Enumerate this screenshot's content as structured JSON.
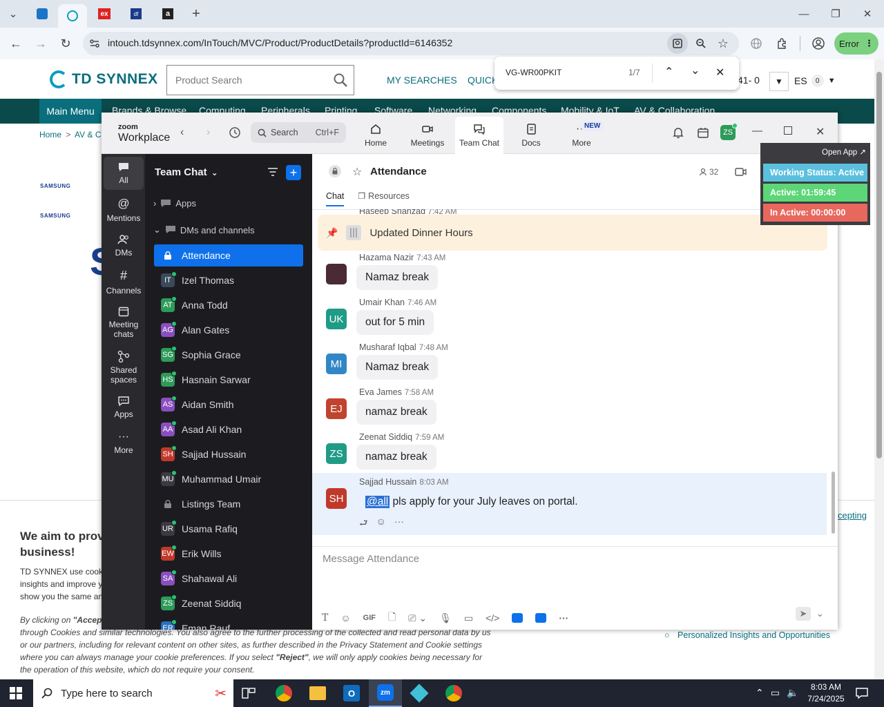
{
  "browser": {
    "url": "intouch.tdsynnex.com/InTouch/MVC/Product/ProductDetails?productId=6146352",
    "error_label": "Error"
  },
  "find_bar": {
    "query": "VG-WR00PKIT",
    "count": "1/7"
  },
  "site": {
    "logo_text": "TD SYNNEX",
    "search_placeholder": "Product Search",
    "my_searches": "MY SEARCHES",
    "quick": "QUICK",
    "cart_count": "41- 0",
    "lang": "ES",
    "lang_badge": "0",
    "main_menu": "Main Menu",
    "nav": [
      "Brands & Browse",
      "Computing",
      "Peripherals",
      "Printing",
      "Software",
      "Networking",
      "Components",
      "Mobility & IoT",
      "AV & Collaboration"
    ],
    "breadcrumb_home": "Home",
    "breadcrumb_sep": ">",
    "breadcrumb_next": "AV & Coll",
    "brand_1": "SAMSUNG",
    "brand_2": "SAMSUNG",
    "big_letter": "S",
    "cookie": {
      "heading_1": "We aim to prov",
      "heading_2": "business!",
      "p1_a": "TD SYNNEX use cook",
      "p1_b": "insights and improve y",
      "p1_c": "show you the same am",
      "p2_a": "By clicking on",
      "p2_b": "\"Accep",
      "p2_c": "through Cookies and similar technologies. You also agree to the further processing of the collected and read personal data by us",
      "p2_d": "or our partners, including for relevant content on other sites, as further described in the Privacy Statement and Cookie settings",
      "p2_e": "where you can always manage your cookie preferences. If you select",
      "p2_reject": "\"Reject\"",
      "p2_f": ", we will only apply cookies being necessary for",
      "p2_g": "the operation of this website, which do not require your consent.",
      "accepting": "cepting",
      "bullet": "Personalized Insights and Opportunities"
    }
  },
  "zoom": {
    "brand_small": "zoom",
    "brand": "Workplace",
    "search_label": "Search",
    "search_shortcut": "Ctrl+F",
    "tabs": [
      {
        "label": "Home"
      },
      {
        "label": "Meetings"
      },
      {
        "label": "Team Chat"
      },
      {
        "label": "Docs"
      },
      {
        "label": "More"
      }
    ],
    "new_badge": "NEW",
    "user_initials": "ZS",
    "rail": [
      {
        "label": "All"
      },
      {
        "label": "Mentions"
      },
      {
        "label": "DMs"
      },
      {
        "label": "Channels"
      },
      {
        "label": "Meeting chats"
      },
      {
        "label": "Shared spaces"
      },
      {
        "label": "Apps"
      },
      {
        "label": "More"
      }
    ],
    "sidebar": {
      "title": "Team Chat",
      "apps": "Apps",
      "dms": "DMs and channels",
      "items": [
        {
          "initials": "",
          "name": "Attendance",
          "color": "#0e71eb"
        },
        {
          "initials": "IT",
          "name": "Izel Thomas",
          "color": "#3a4a5a"
        },
        {
          "initials": "AT",
          "name": "Anna Todd",
          "color": "#2e9b59"
        },
        {
          "initials": "AG",
          "name": "Alan Gates",
          "color": "#8a4fbf"
        },
        {
          "initials": "SG",
          "name": "Sophia Grace",
          "color": "#2e9b59"
        },
        {
          "initials": "HS",
          "name": "Hasnain Sarwar",
          "color": "#2e9b59"
        },
        {
          "initials": "AS",
          "name": "Aidan Smith",
          "color": "#8a4fbf"
        },
        {
          "initials": "AA",
          "name": "Asad Ali Khan",
          "color": "#8a4fbf"
        },
        {
          "initials": "SH",
          "name": "Sajjad Hussain",
          "color": "#c0392b"
        },
        {
          "initials": "MU",
          "name": "Muhammad Umair",
          "color": "#3a3a40"
        },
        {
          "initials": "",
          "name": "Listings Team",
          "color": "#3a3a40"
        },
        {
          "initials": "UR",
          "name": "Usama Rafiq",
          "color": "#3a3a40"
        },
        {
          "initials": "EW",
          "name": "Erik Wills",
          "color": "#c0392b"
        },
        {
          "initials": "SA",
          "name": "Shahawal Ali",
          "color": "#8a4fbf"
        },
        {
          "initials": "ZS",
          "name": "Zeenat Siddiq",
          "color": "#2e9b59"
        },
        {
          "initials": "ER",
          "name": "Eman Rauf",
          "color": "#2a6fbf"
        }
      ]
    },
    "channel": {
      "name": "Attendance",
      "members": "32",
      "tab_chat": "Chat",
      "tab_resources": "Resources",
      "cut_name": "Haseeb Shahzad",
      "cut_time": "7:42 AM",
      "pinned": "Updated Dinner Hours",
      "composer_placeholder": "Message Attendance",
      "messages": [
        {
          "initials": "",
          "name": "Hazama Nazir",
          "time": "7:43 AM",
          "text": "Namaz break",
          "color": "#4a2a35"
        },
        {
          "initials": "UK",
          "name": "Umair Khan",
          "time": "7:46 AM",
          "text": "out for 5 min",
          "color": "#1f9b86"
        },
        {
          "initials": "MI",
          "name": "Musharaf Iqbal",
          "time": "7:48 AM",
          "text": "Namaz break",
          "color": "#3187c6"
        },
        {
          "initials": "EJ",
          "name": "Eva James",
          "time": "7:58 AM",
          "text": "namaz break",
          "color": "#c0432e"
        },
        {
          "initials": "ZS",
          "name": "Zeenat Siddiq",
          "time": "7:59 AM",
          "text": "namaz break",
          "color": "#1f9b86"
        },
        {
          "initials": "SH",
          "name": "Sajjad Hussain",
          "time": "8:03 AM",
          "mention": "@all",
          "text": " pls apply for your July leaves on portal.",
          "color": "#c0392b"
        }
      ],
      "toolbar_gif": "GIF"
    }
  },
  "status_widget": {
    "open_app": "Open App ↗",
    "working": "Working Status: Active",
    "active": "Active: 01:59:45",
    "inactive": "In Active: 00:00:00",
    "colors": {
      "working": "#5bc0de",
      "active": "#5cd677",
      "inactive": "#e8685e"
    }
  },
  "taskbar": {
    "search_placeholder": "Type here to search",
    "time": "8:03 AM",
    "date": "7/24/2025"
  }
}
